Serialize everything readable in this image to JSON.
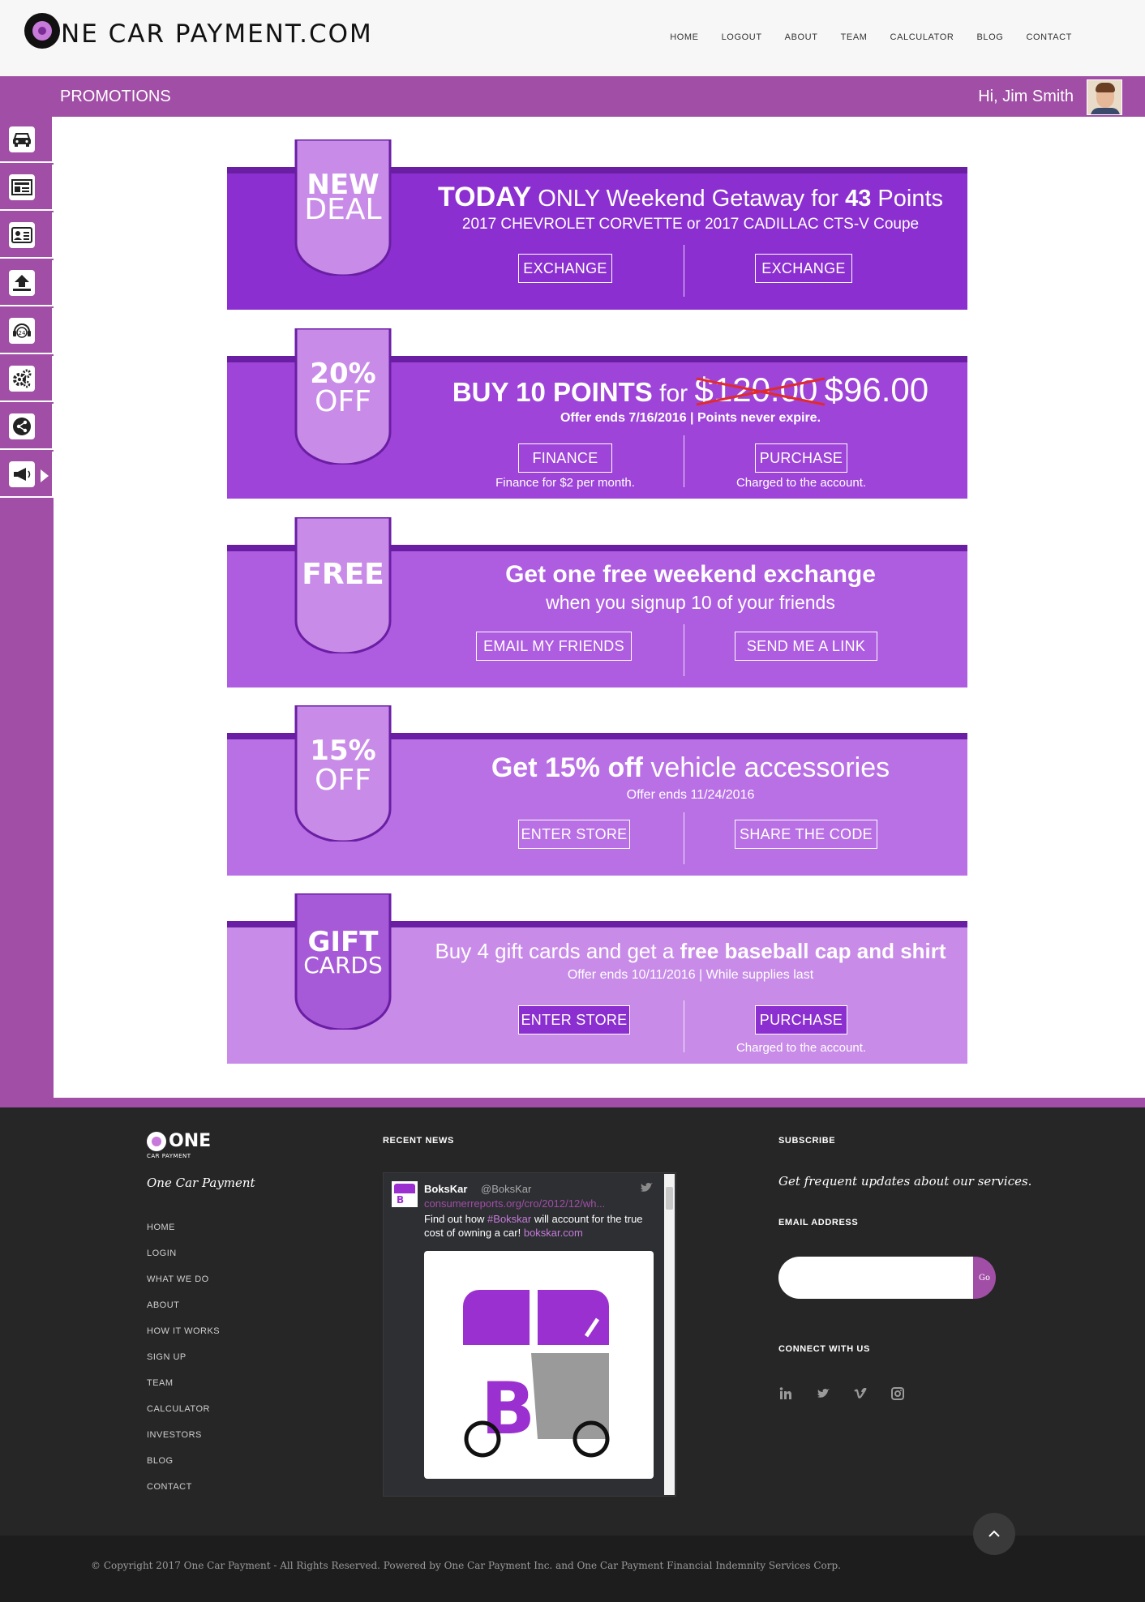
{
  "header": {
    "logo_text": "NE CAR PAYMENT.COM",
    "nav": [
      "HOME",
      "LOGOUT",
      "ABOUT",
      "TEAM",
      "CALCULATOR",
      "BLOG",
      "CONTACT"
    ]
  },
  "bar": {
    "title": "PROMOTIONS",
    "greeting": "Hi, Jim Smith"
  },
  "sidebar": {
    "icons": [
      "car-icon",
      "id-card-icon",
      "contact-card-icon",
      "upload-icon",
      "support-24-icon",
      "settings-icon",
      "share-icon",
      "megaphone-icon"
    ]
  },
  "promos": [
    {
      "ribbon_top": "NEW",
      "ribbon_bottom": "DEAL",
      "headline_bold": "TODAY",
      "headline_rest": " ONLY  Weekend Getaway for ",
      "headline_points": "43",
      "headline_end": " Points",
      "sub": "2017 CHEVROLET CORVETTE  or  2017 CADILLAC CTS-V Coupe",
      "btn_left": "EXCHANGE",
      "btn_right": "EXCHANGE",
      "note_left": "",
      "note_right": "",
      "bg": "#8c2fd0",
      "ribbon_bg": "#c88ce8"
    },
    {
      "ribbon_top": "20%",
      "ribbon_bottom": "OFF",
      "headline_bold": "BUY 10 POINTS",
      "headline_for": " for ",
      "old_price": "$120.00",
      "new_price": "$96.00",
      "sub": "Offer ends 7/16/2016  |  Points never expire.",
      "btn_left": "FINANCE",
      "btn_right": "PURCHASE",
      "note_left": "Finance for $2 per month.",
      "note_right": "Charged to the account.",
      "bg": "#9e44d8",
      "ribbon_bg": "#c88ce8"
    },
    {
      "ribbon_top": "FREE",
      "ribbon_bottom": "",
      "headline": "Get one free weekend exchange",
      "sub": "when you signup 10 of your friends",
      "btn_left": "EMAIL MY FRIENDS",
      "btn_right": "SEND ME A LINK",
      "note_left": "",
      "note_right": "",
      "bg": "#ae5de0",
      "ribbon_bg": "#c88ce8"
    },
    {
      "ribbon_top": "15%",
      "ribbon_bottom": "OFF",
      "headline_bold": "Get 15% off",
      "headline_rest": " vehicle accessories",
      "sub": "Offer ends 11/24/2016",
      "btn_left": "ENTER STORE",
      "btn_right": "SHARE  THE CODE",
      "note_left": "",
      "note_right": "",
      "bg": "#b970e5",
      "ribbon_bg": "#c88ce8"
    },
    {
      "ribbon_top": "GIFT",
      "ribbon_bottom": "CARDS",
      "headline_rest": "Buy 4 gift cards and get a ",
      "headline_bold": "free baseball cap and shirt",
      "sub": "Offer ends 10/11/2016  |  While supplies last",
      "btn_left": "ENTER STORE",
      "btn_right": "PURCHASE",
      "note_left": "",
      "note_right": "Charged to the account.",
      "bg": "#c88ce8",
      "ribbon_bg": "#a65ad8"
    }
  ],
  "footer": {
    "logo_main": "ONE",
    "logo_sub": "CAR PAYMENT",
    "brand": "One Car Payment",
    "links": [
      "HOME",
      "LOGIN",
      "WHAT WE DO",
      "ABOUT",
      "HOW IT WORKS",
      "SIGN UP",
      "TEAM",
      "CALCULATOR",
      "INVESTORS",
      "BLOG",
      "CONTACT"
    ],
    "recent_news": "RECENT NEWS",
    "subscribe": "SUBSCRIBE",
    "subscribe_text": "Get frequent updates about our services.",
    "email_label": "EMAIL ADDRESS",
    "go": "Go",
    "connect": "CONNECT WITH US",
    "tweet": {
      "name": "BoksKar",
      "handle": "@BoksKar",
      "link": "consumerreports.org/cro/2012/12/wh...",
      "text_1": "Find out how ",
      "hashtag": "#Bokskar",
      "text_2": " will account for the true cost of owning a car! ",
      "url": "bokskar.com"
    },
    "copyright": "© Copyright 2017 One Car Payment - All Rights Reserved. Powered by One Car Payment Inc. and One Car Payment Financial Indemnity Services Corp."
  }
}
